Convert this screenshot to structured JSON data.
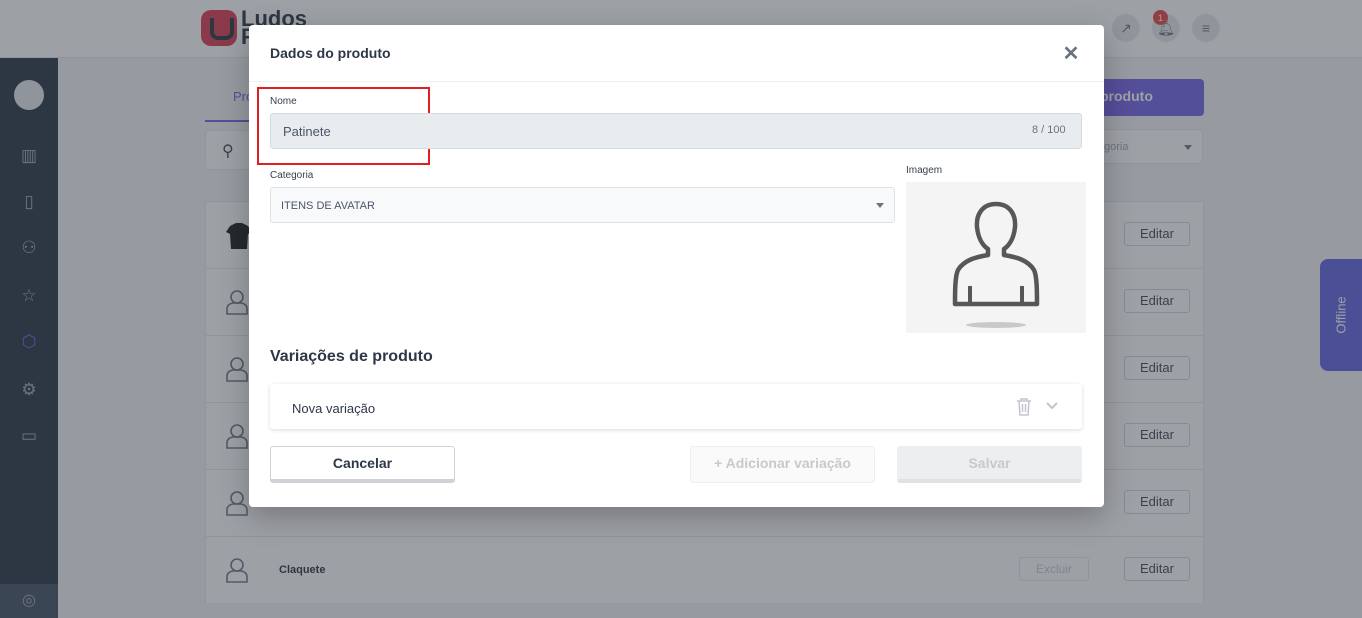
{
  "app": {
    "logo_text_line1": "Ludos",
    "logo_text_line2": "P"
  },
  "header": {
    "notification_count": "1"
  },
  "background": {
    "tab_label": "Pro",
    "primary_button": "produto",
    "category_filter": "goria",
    "rows": [
      {
        "name": "",
        "edit": "Editar"
      },
      {
        "name": "",
        "edit": "Editar"
      },
      {
        "name": "",
        "edit": "Editar"
      },
      {
        "name": "",
        "edit": "Editar"
      },
      {
        "name": "",
        "edit": "Editar"
      },
      {
        "name": "Claquete",
        "excluir": "Excluir",
        "edit": "Editar"
      }
    ]
  },
  "offline_label": "Offline",
  "modal": {
    "title": "Dados do produto",
    "name_label": "Nome",
    "name_value": "Patinete",
    "name_counter": "8 / 100",
    "category_label": "Categoria",
    "category_value": "ITENS DE AVATAR",
    "image_label": "Imagem",
    "variations_title": "Variações de produto",
    "variation_item": "Nova variação",
    "cancel_label": "Cancelar",
    "add_variation_label": "+ Adicionar variação",
    "save_label": "Salvar"
  },
  "colors": {
    "accent": "#6c5ce7",
    "sidebar": "#1f2d3d",
    "highlight": "#e02020"
  }
}
